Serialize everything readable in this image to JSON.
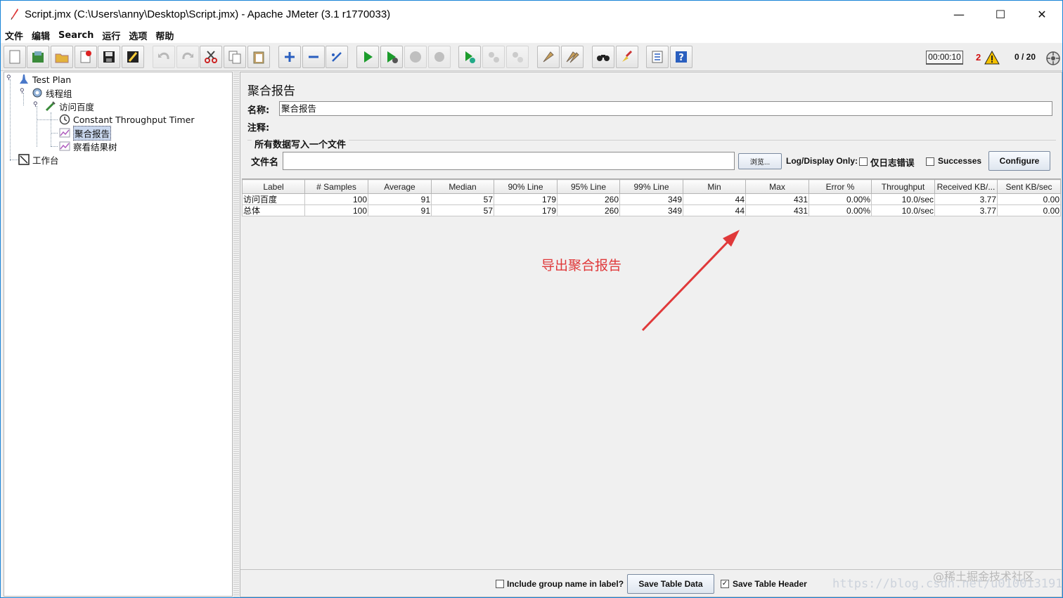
{
  "window": {
    "title": "Script.jmx (C:\\Users\\anny\\Desktop\\Script.jmx) - Apache JMeter (3.1 r1770033)",
    "controls": {
      "minimize": "—",
      "maximize": "☐",
      "close": "✕"
    }
  },
  "menubar": [
    "文件",
    "编辑",
    "Search",
    "运行",
    "选项",
    "帮助"
  ],
  "toolbar": {
    "timer": "00:00:10",
    "error_count": "2",
    "threads": "0 / 20",
    "icons": [
      "new-icon",
      "templates-icon",
      "open-icon",
      "close-icon",
      "save-icon",
      "save-as-icon",
      "undo-icon",
      "redo-icon",
      "cut-icon",
      "copy-icon",
      "paste-icon",
      "expand-icon",
      "collapse-icon",
      "toggle-icon",
      "start-icon",
      "start-no-pause-icon",
      "stop-icon",
      "shutdown-icon",
      "remote-start-icon",
      "remote-stop-icon",
      "remote-shutdown-icon",
      "clear-icon",
      "clear-all-icon",
      "search-icon",
      "reset-search-icon",
      "function-helper-icon",
      "help-icon"
    ]
  },
  "tree": {
    "items": [
      {
        "label": "Test Plan",
        "icon": "testplan-icon"
      },
      {
        "label": "线程组",
        "icon": "gear-icon"
      },
      {
        "label": "访问百度",
        "icon": "sampler-icon"
      },
      {
        "label": "Constant Throughput Timer",
        "icon": "timer-icon"
      },
      {
        "label": "聚合报告",
        "icon": "report-icon",
        "selected": true
      },
      {
        "label": "察看结果树",
        "icon": "report-icon"
      },
      {
        "label": "工作台",
        "icon": "workbench-icon"
      }
    ]
  },
  "panel": {
    "title": "聚合报告",
    "name_label": "名称:",
    "name_value": "聚合报告",
    "comment_label": "注释:",
    "comment_value": "",
    "file_section_title": "所有数据写入一个文件",
    "file_label": "文件名",
    "file_value": "",
    "browse_button": "浏览...",
    "log_display_only": "Log/Display Only:",
    "errors_only_label": "仅日志错误",
    "errors_only_checked": false,
    "successes_label": "Successes",
    "successes_checked": false,
    "configure_button": "Configure"
  },
  "table": {
    "columns": [
      "Label",
      "# Samples",
      "Average",
      "Median",
      "90% Line",
      "95% Line",
      "99% Line",
      "Min",
      "Max",
      "Error %",
      "Throughput",
      "Received KB/...",
      "Sent KB/sec"
    ],
    "rows": [
      [
        "访问百度",
        "100",
        "91",
        "57",
        "179",
        "260",
        "349",
        "44",
        "431",
        "0.00%",
        "10.0/sec",
        "3.77",
        "0.00"
      ],
      [
        "总体",
        "100",
        "91",
        "57",
        "179",
        "260",
        "349",
        "44",
        "431",
        "0.00%",
        "10.0/sec",
        "3.77",
        "0.00"
      ]
    ]
  },
  "bottom": {
    "include_group_label": "Include group name in label?",
    "include_group_checked": false,
    "save_table_data": "Save Table Data",
    "save_table_header_label": "Save Table Header",
    "save_table_header_checked": true
  },
  "annotation": {
    "text": "导出聚合报告",
    "color": "#e0393a"
  },
  "watermarks": {
    "line1": "@稀土掘金技术社区",
    "line2": "https://blog.csdn.net/u010013191"
  }
}
